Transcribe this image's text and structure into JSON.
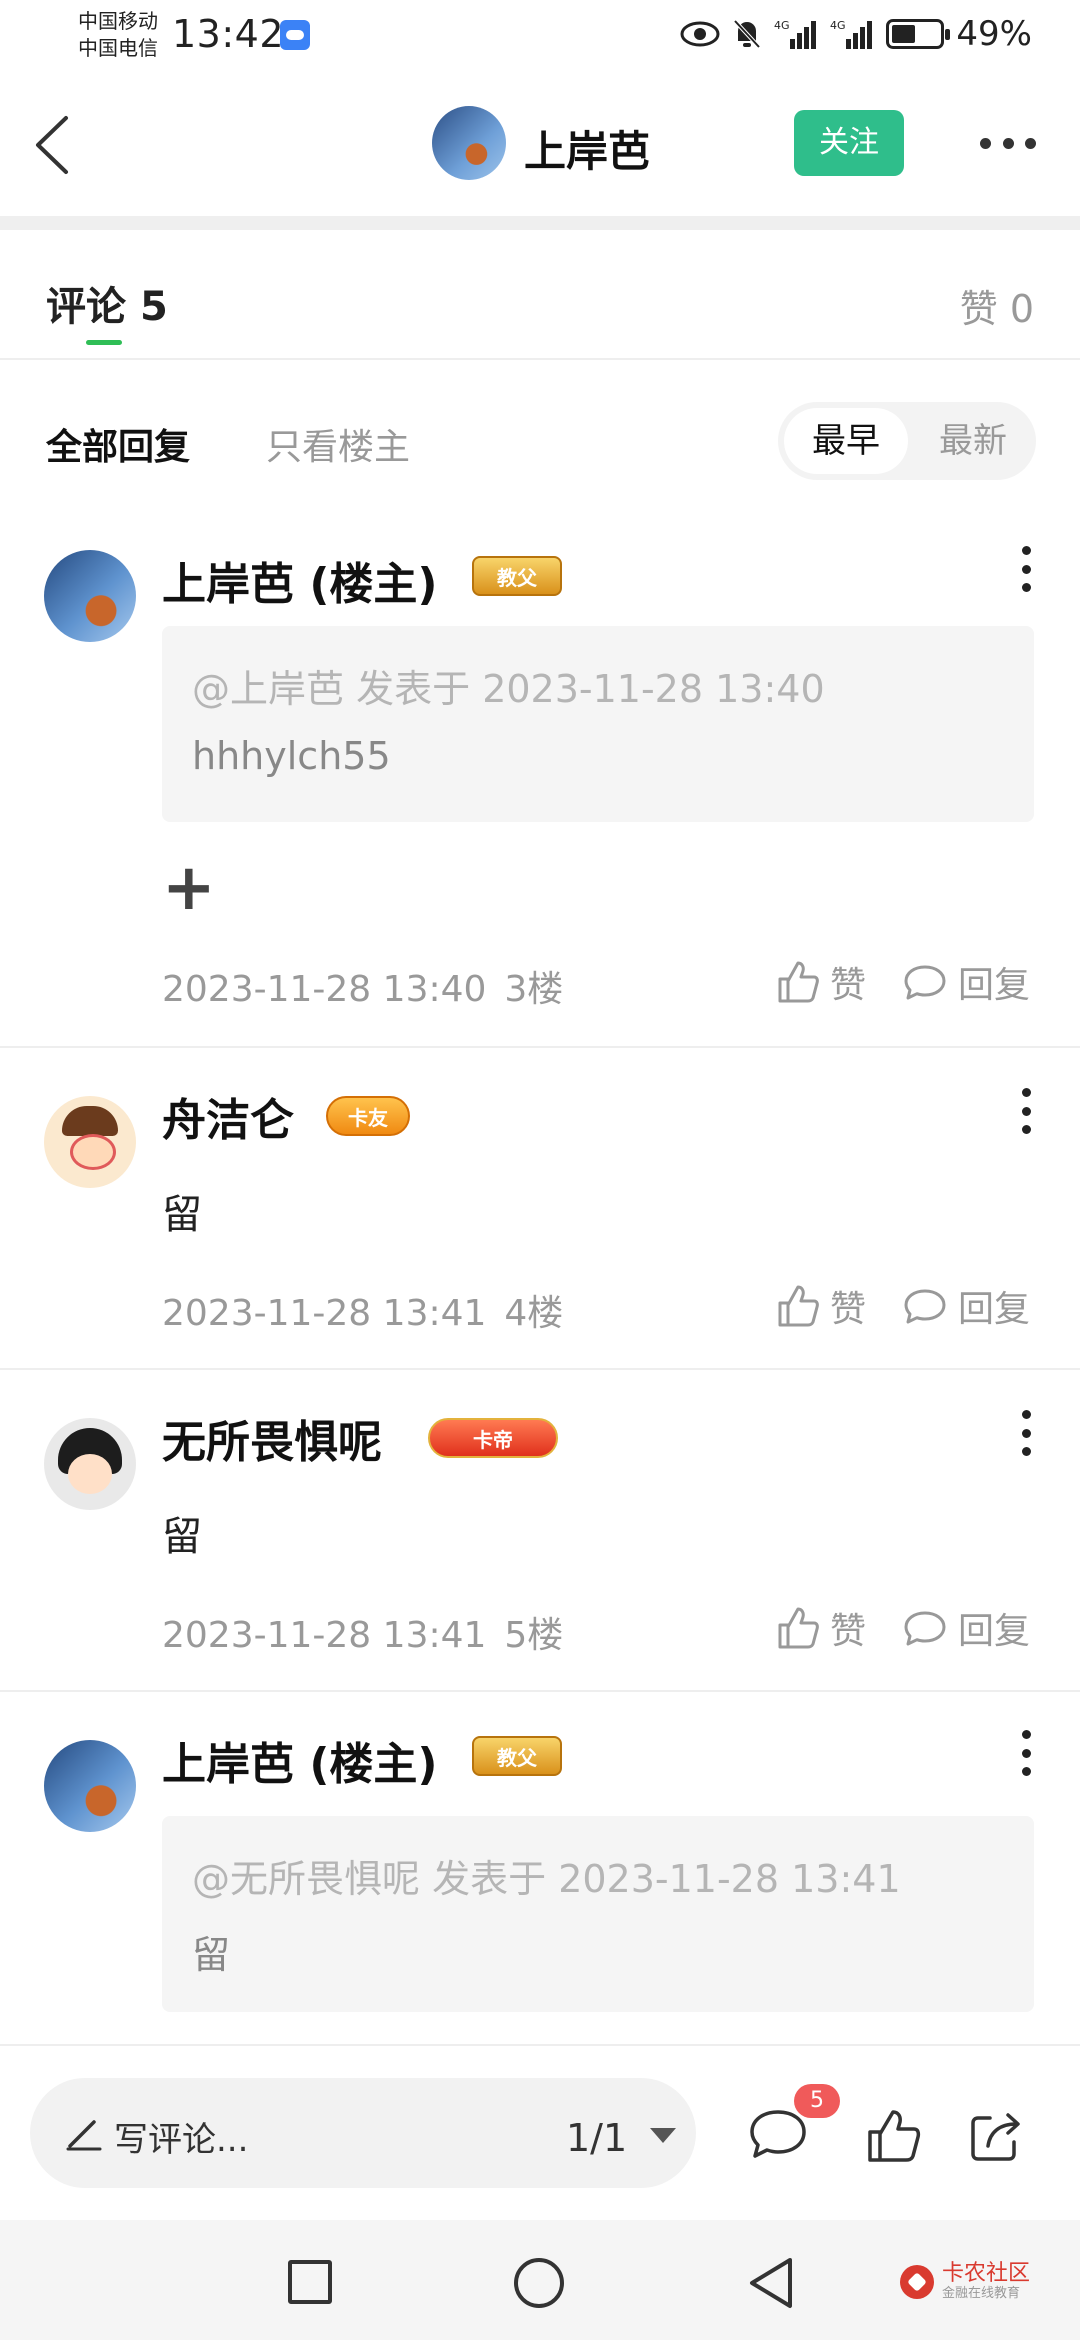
{
  "status_bar": {
    "carrier_1": "中国移动",
    "carrier_2": "中国电信",
    "time": "13:42",
    "battery": "49%",
    "battery_level": 0.49,
    "icons": [
      "cloud-icon",
      "eye-icon",
      "bell-off-icon",
      "signal-4g-icon",
      "signal-4g-icon",
      "battery-icon"
    ]
  },
  "header": {
    "title": "上岸芭",
    "follow_label": "关注"
  },
  "tabs": {
    "comments_label": "评论",
    "comments_count": "5",
    "likes_label": "赞",
    "likes_count": "0",
    "accent_color": "#2fbe56"
  },
  "filters": {
    "all_replies": "全部回复",
    "op_only": "只看楼主",
    "sort_earliest": "最早",
    "sort_latest": "最新"
  },
  "comments": [
    {
      "name": "上岸芭 (楼主)",
      "badge": "教父",
      "quote_author": "@上岸芭",
      "quote_posted": "发表于 2023-11-28 13:40",
      "quote_text": "hhhylch55",
      "text": "+",
      "time": "2023-11-28 13:40",
      "floor": "3楼",
      "like_label": "赞",
      "reply_label": "回复"
    },
    {
      "name": "舟洁仑",
      "badge": "卡友",
      "text": "留",
      "time": "2023-11-28 13:41",
      "floor": "4楼",
      "like_label": "赞",
      "reply_label": "回复"
    },
    {
      "name": "无所畏惧呢",
      "badge": "卡帝",
      "text": "留",
      "time": "2023-11-28 13:41",
      "floor": "5楼",
      "like_label": "赞",
      "reply_label": "回复"
    },
    {
      "name": "上岸芭 (楼主)",
      "badge": "教父",
      "quote_author": "@无所畏惧呢",
      "quote_posted": "发表于 2023-11-28 13:41",
      "quote_text": "留"
    }
  ],
  "bottom_bar": {
    "write_placeholder": "写评论...",
    "page_indicator": "1/1",
    "comment_count": "5",
    "brand_color": "#2fbe8b"
  },
  "watermark": {
    "name": "卡农社区",
    "tagline": "金融在线教育"
  }
}
